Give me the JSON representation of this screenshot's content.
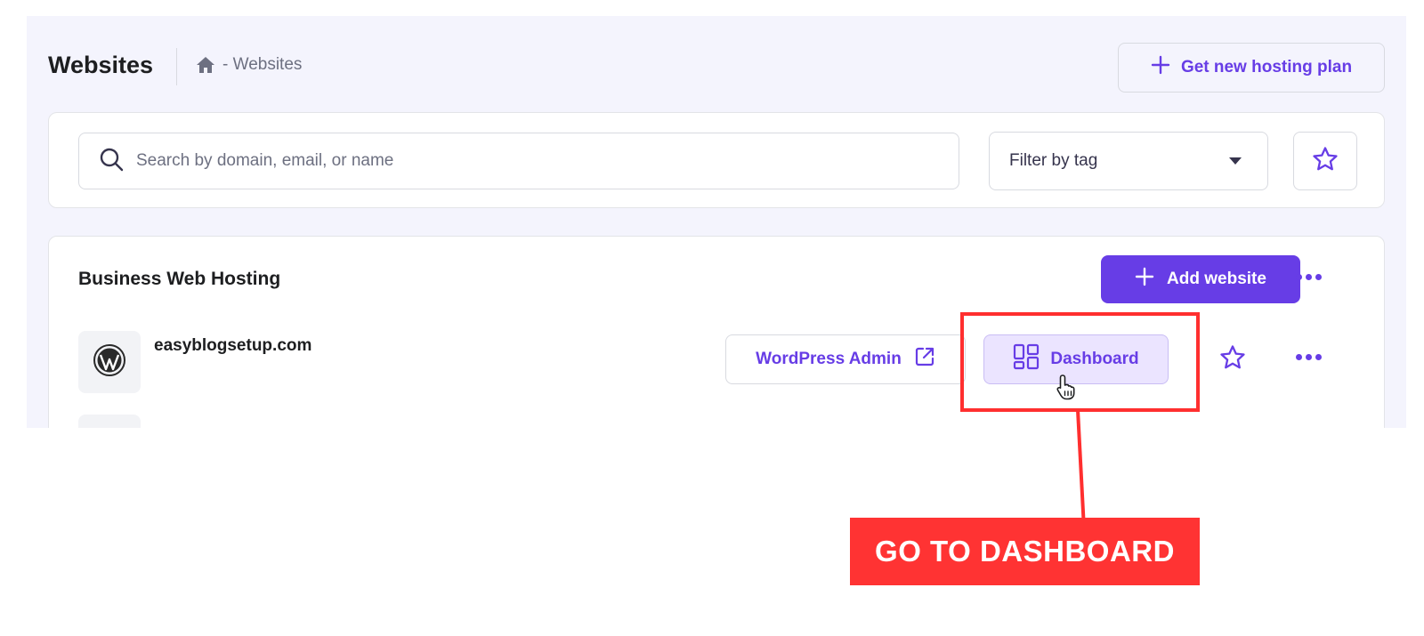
{
  "header": {
    "title": "Websites",
    "breadcrumb": {
      "icon": "home-icon",
      "text": "- Websites"
    },
    "get_plan_label": "Get new hosting plan"
  },
  "search": {
    "placeholder": "Search by domain, email, or name",
    "value": "",
    "filter_label": "Filter by tag"
  },
  "hosting": {
    "section_title": "Business Web Hosting",
    "add_website_label": "Add website",
    "websites": [
      {
        "domain": "easyblogsetup.com",
        "logo": "wordpress-icon",
        "wp_admin_label": "WordPress Admin",
        "dashboard_label": "Dashboard"
      }
    ]
  },
  "annotation": {
    "callout_text": "GO TO DASHBOARD"
  },
  "colors": {
    "accent": "#673de6",
    "accent_light": "#ebe4ff",
    "panel_bg": "#f4f4fd",
    "annotation_red": "#ff2f2f"
  }
}
